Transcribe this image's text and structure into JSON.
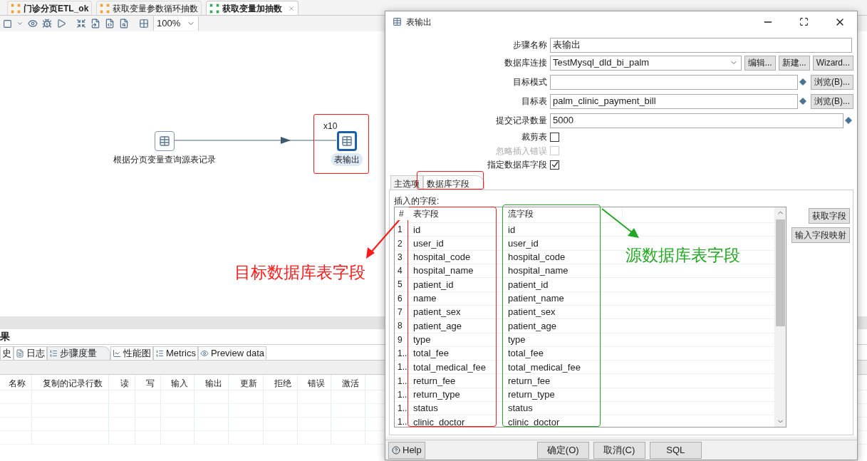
{
  "app": {
    "tabs": [
      {
        "label": "门诊分页ETL_ok",
        "bold": true,
        "selected": false,
        "closable": false
      },
      {
        "label": "获取变量参数循环抽数",
        "bold": false,
        "selected": false,
        "closable": false
      },
      {
        "label": "获取变量加抽数",
        "bold": true,
        "selected": true,
        "closable": true
      }
    ],
    "toolbar": {
      "zoom": "100%"
    },
    "canvas": {
      "nodes": [
        {
          "label": "根据分页变量查询源表记录",
          "selected": false
        },
        {
          "label": "表输出",
          "selected": true,
          "copies": "x10"
        }
      ]
    },
    "bottom_panel": {
      "title": "果",
      "tabs": [
        {
          "label": "史",
          "selected": false
        },
        {
          "label": "日志",
          "selected": false
        },
        {
          "label": "步骤度量",
          "selected": true
        },
        {
          "label": "性能图",
          "selected": false
        },
        {
          "label": "Metrics",
          "selected": false
        },
        {
          "label": "Preview data",
          "selected": false
        }
      ],
      "columns": [
        "名称",
        "复制的记录行数",
        "读",
        "写",
        "输入",
        "输出",
        "更新",
        "拒绝",
        "错误",
        "激活"
      ]
    }
  },
  "dialog": {
    "title": "表输出",
    "fields": [
      {
        "kind": "text",
        "label": "步骤名称",
        "value": "表输出",
        "variable": false
      },
      {
        "kind": "combo",
        "label": "数据库连接",
        "value": "TestMysql_dld_bi_palm",
        "buttons": [
          "编辑...",
          "新建...",
          "Wizard..."
        ]
      },
      {
        "kind": "text",
        "label": "目标模式",
        "variable": true,
        "buttons": [
          "浏览(B)..."
        ]
      },
      {
        "kind": "text",
        "label": "目标表",
        "value": "palm_clinic_payment_bill",
        "variable": true,
        "buttons": [
          "浏览(B)..."
        ]
      },
      {
        "kind": "text",
        "label": "提交记录数量",
        "value": "5000",
        "variable": true
      },
      {
        "kind": "checkbox",
        "label": "裁剪表",
        "checked": false,
        "disabled": false
      },
      {
        "kind": "checkbox",
        "label": "忽略插入错误",
        "checked": false,
        "disabled": true
      },
      {
        "kind": "checkbox",
        "label": "指定数据库字段",
        "checked": true,
        "disabled": false
      }
    ],
    "tabs": [
      {
        "label": "主选项",
        "selected": false
      },
      {
        "label": "数据库字段",
        "selected": true
      }
    ],
    "table_label": "插入的字段:",
    "table": {
      "columns": [
        "#",
        "表字段",
        "流字段"
      ],
      "rows": [
        [
          "1",
          "id",
          "id"
        ],
        [
          "2",
          "user_id",
          "user_id"
        ],
        [
          "3",
          "hospital_code",
          "hospital_code"
        ],
        [
          "4",
          "hospital_name",
          "hospital_name"
        ],
        [
          "5",
          "patient_id",
          "patient_id"
        ],
        [
          "6",
          "name",
          "patient_name"
        ],
        [
          "7",
          "patient_sex",
          "patient_sex"
        ],
        [
          "8",
          "patient_age",
          "patient_age"
        ],
        [
          "9",
          "type",
          "type"
        ],
        [
          "1..",
          "total_fee",
          "total_fee"
        ],
        [
          "1..",
          "total_medical_fee",
          "total_medical_fee"
        ],
        [
          "1..",
          "return_fee",
          "return_fee"
        ],
        [
          "1..",
          "return_type",
          "return_type"
        ],
        [
          "1..",
          "status",
          "status"
        ],
        [
          "1..",
          "clinic_doctor",
          "clinic_doctor"
        ]
      ]
    },
    "side_buttons": [
      "获取字段",
      "输入字段映射"
    ],
    "help": "Help",
    "buttons": [
      "确定(O)",
      "取消(C)",
      "SQL"
    ]
  },
  "annotations": [
    {
      "text": "目标数据库表字段",
      "color": "#ff1a1a"
    },
    {
      "text": "源数据库表字段",
      "color": "#22a822"
    }
  ]
}
